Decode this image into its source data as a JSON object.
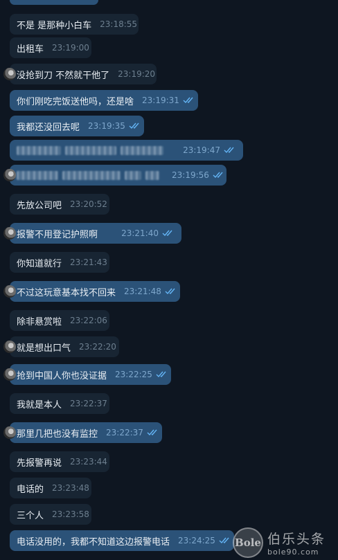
{
  "colors": {
    "background": "#0e1621",
    "incoming_bubble": "#182533",
    "outgoing_bubble": "#2b5278",
    "text": "#e9eef3",
    "read_check": "#64b5f6"
  },
  "messages": [
    {
      "dir": "in",
      "text": "不是 是那种小白车",
      "time": "23:18:55"
    },
    {
      "dir": "in",
      "text": "出租车",
      "time": "23:19:00"
    },
    {
      "dir": "in",
      "text": "没抢到刀 不然就干他了",
      "time": "23:19:20",
      "avatar": true
    },
    {
      "dir": "out",
      "text": "你们刚吃完饭送他吗，还是啥",
      "time": "23:19:31",
      "read": true
    },
    {
      "dir": "out",
      "text": "我都还没回去呢",
      "time": "23:19:35",
      "read": true
    },
    {
      "dir": "out",
      "text": "",
      "time": "23:19:47",
      "read": true,
      "redacted": true
    },
    {
      "dir": "out",
      "text": "",
      "time": "23:19:56",
      "read": true,
      "redacted": true,
      "avatar": true
    },
    {
      "dir": "in",
      "text": "先放公司吧",
      "time": "23:20:52"
    },
    {
      "dir": "out",
      "text": "报警不用登记护照啊",
      "time": "23:21:40",
      "read": true,
      "avatar": true
    },
    {
      "dir": "in",
      "text": "你知道就行",
      "time": "23:21:43"
    },
    {
      "dir": "out",
      "text": "不过这玩意基本找不回来",
      "time": "23:21:48",
      "read": true,
      "avatar": true
    },
    {
      "dir": "in",
      "text": "除非悬赏啦",
      "time": "23:22:06"
    },
    {
      "dir": "in",
      "text": "就是想出口气",
      "time": "23:22:20",
      "avatar": true
    },
    {
      "dir": "out",
      "text": "抢到中国人你也没证据",
      "time": "23:22:25",
      "read": true,
      "avatar": true
    },
    {
      "dir": "in",
      "text": "我就是本人",
      "time": "23:22:37"
    },
    {
      "dir": "out",
      "text": "那里几把也没有监控",
      "time": "23:22:37",
      "read": true,
      "avatar": true
    },
    {
      "dir": "in",
      "text": "先报警再说",
      "time": "23:23:44"
    },
    {
      "dir": "in",
      "text": "电话的",
      "time": "23:23:48"
    },
    {
      "dir": "in",
      "text": "三个人",
      "time": "23:23:58"
    },
    {
      "dir": "out",
      "text": "电话没用的，我都不知道这边报警电话",
      "time": "23:24:25",
      "read": true
    }
  ],
  "watermark": {
    "logo_text": "Bole",
    "title": "伯乐头条",
    "url": "bole90.com"
  }
}
